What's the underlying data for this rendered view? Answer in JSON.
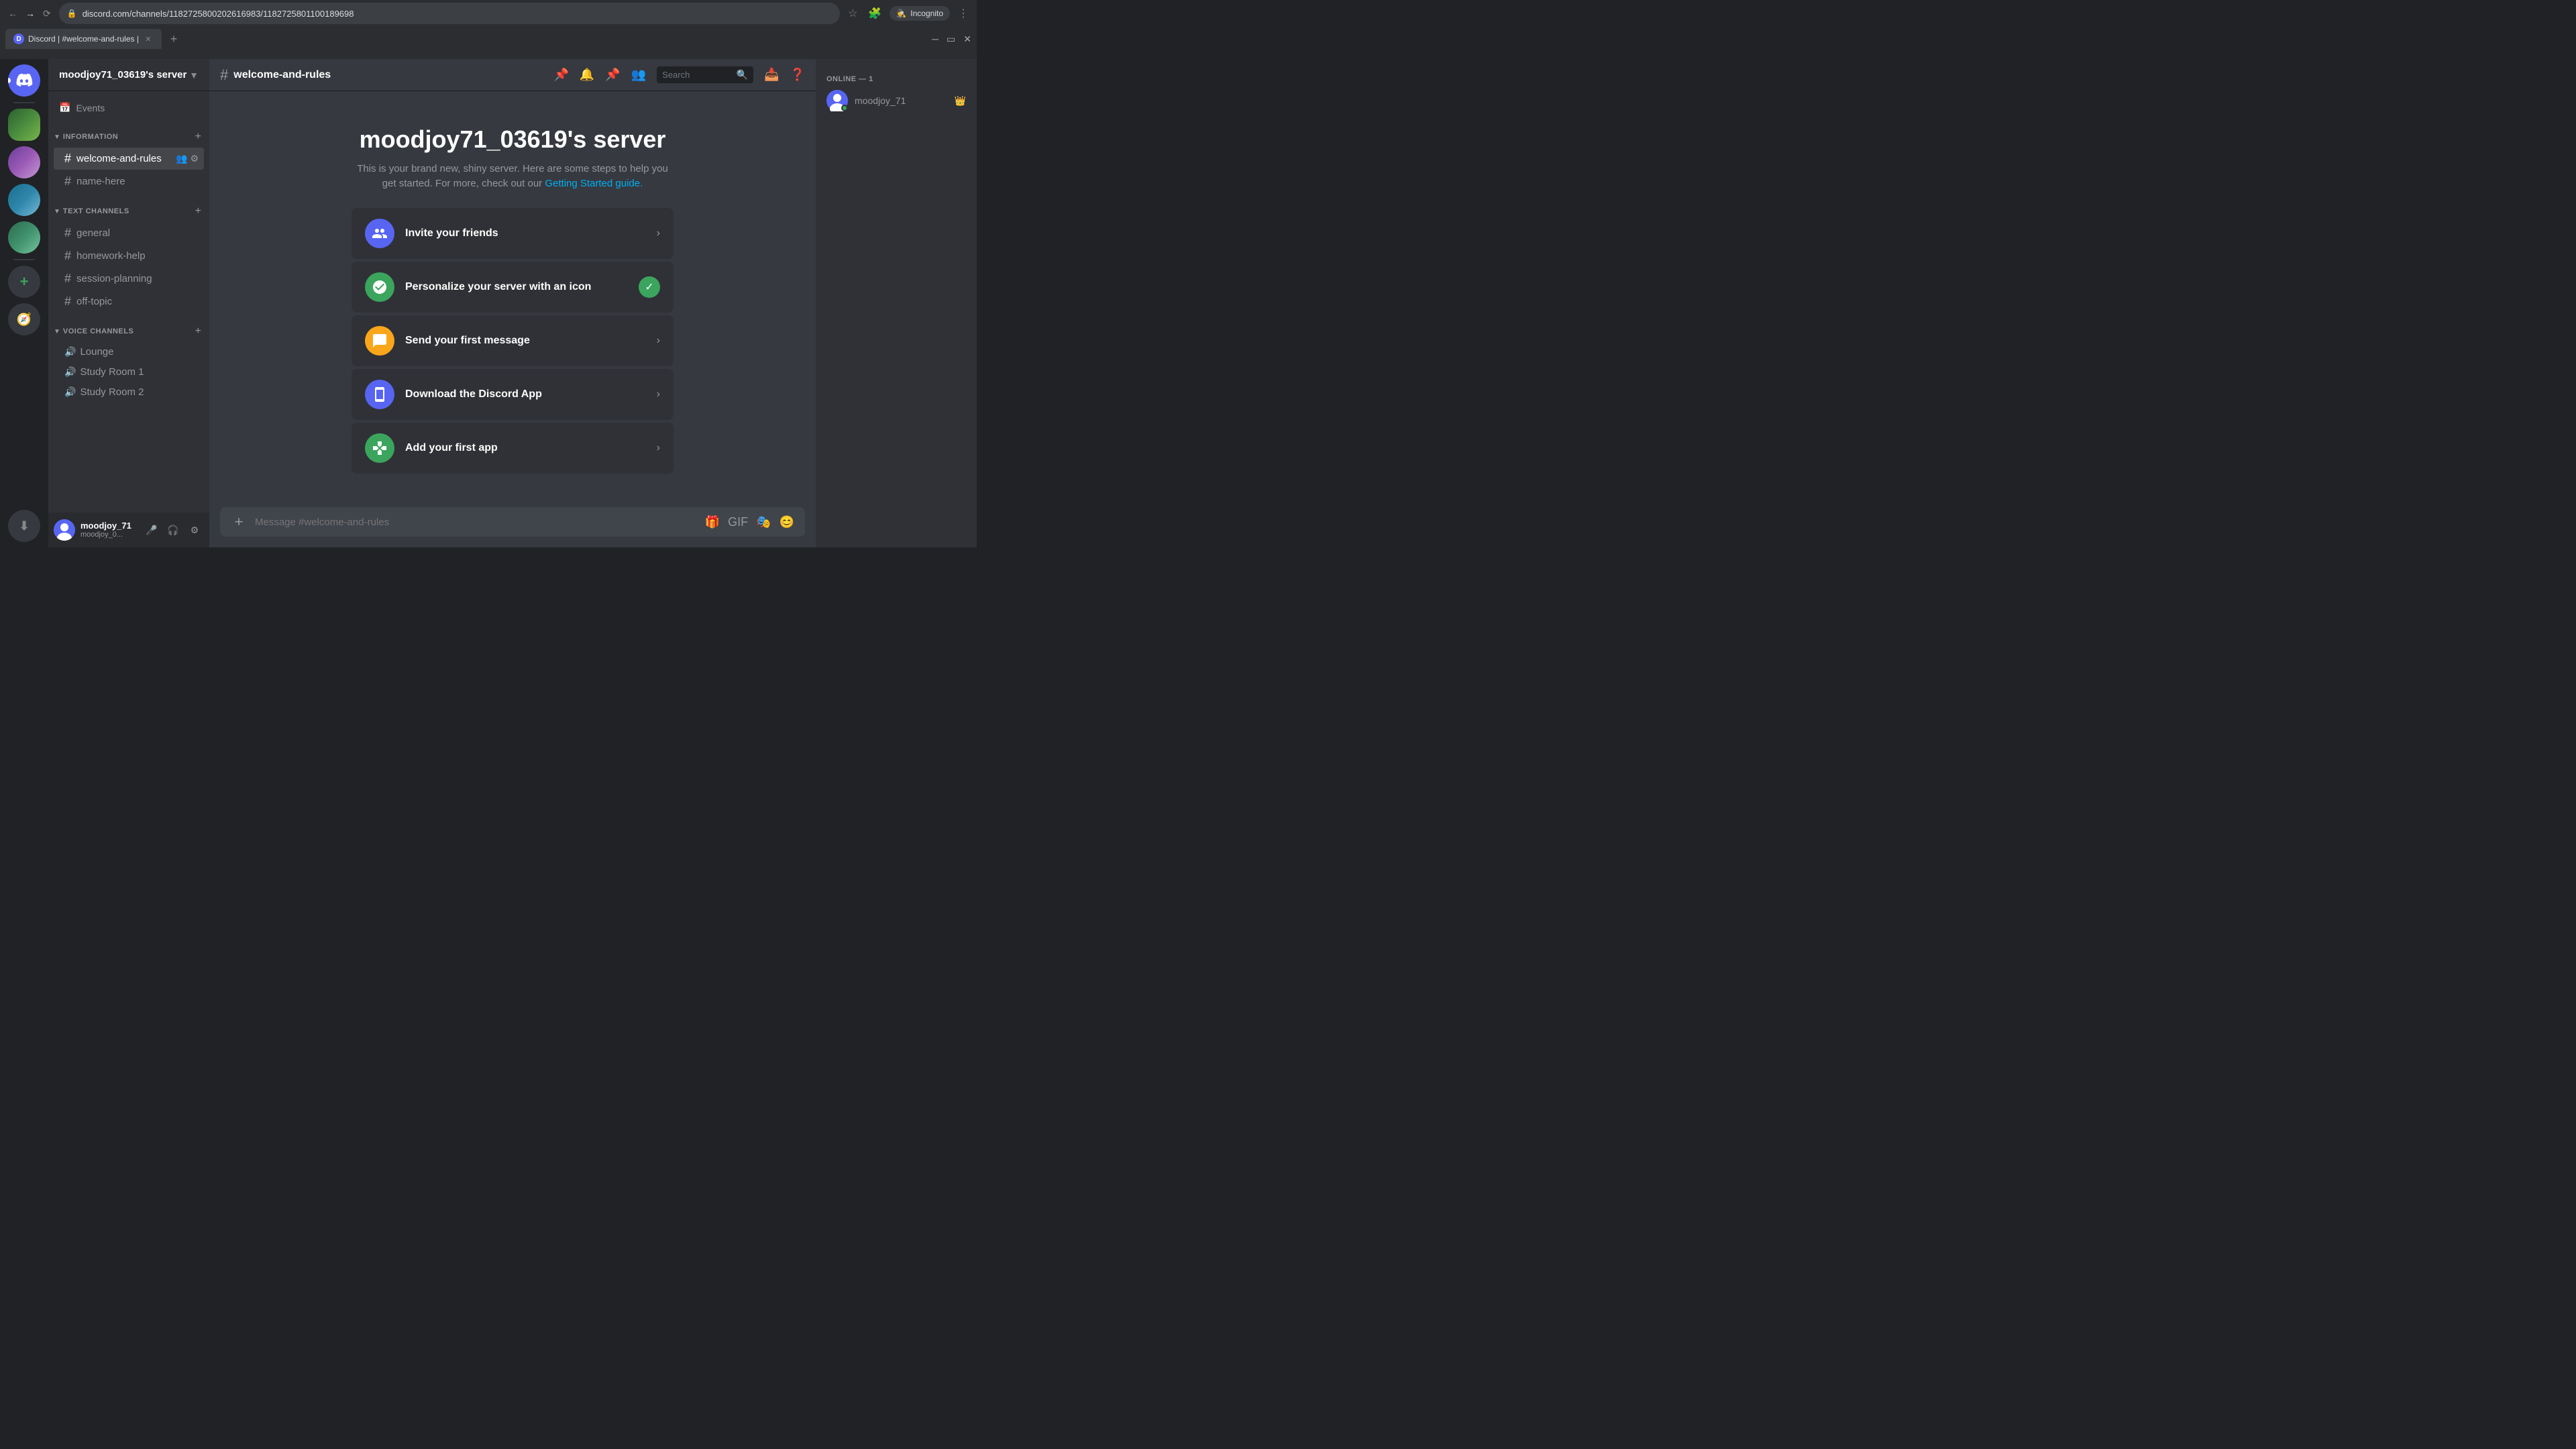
{
  "browser": {
    "tab_title": "Discord | #welcome-and-rules |",
    "url": "discord.com/channels/1182725800202616983/1182725801100189698",
    "incognito_label": "Incognito"
  },
  "sidebar": {
    "servers": [
      {
        "id": "discord-home",
        "label": "Discord Home",
        "type": "home"
      },
      {
        "id": "server-1",
        "label": "Server 1",
        "type": "image"
      },
      {
        "id": "server-2",
        "label": "Server 2",
        "type": "image"
      },
      {
        "id": "server-3",
        "label": "Server 3",
        "type": "image"
      },
      {
        "id": "server-4",
        "label": "Server 4",
        "type": "image"
      }
    ],
    "add_server_label": "Add a Server",
    "discover_label": "Explore Public Servers",
    "download_label": "Download Apps"
  },
  "channel_sidebar": {
    "server_name": "moodjoy71_03619's server",
    "events_label": "Events",
    "categories": [
      {
        "id": "information",
        "name": "INFORMATION",
        "channels": [
          {
            "id": "welcome-and-rules",
            "name": "welcome-and-rules",
            "active": true,
            "type": "text"
          },
          {
            "id": "name-here",
            "name": "name-here",
            "active": false,
            "type": "text"
          }
        ]
      },
      {
        "id": "text-channels",
        "name": "TEXT CHANNELS",
        "channels": [
          {
            "id": "general",
            "name": "general",
            "active": false,
            "type": "text"
          },
          {
            "id": "homework-help",
            "name": "homework-help",
            "active": false,
            "type": "text"
          },
          {
            "id": "session-planning",
            "name": "session-planning",
            "active": false,
            "type": "text"
          },
          {
            "id": "off-topic",
            "name": "off-topic",
            "active": false,
            "type": "text"
          }
        ]
      },
      {
        "id": "voice-channels",
        "name": "VOICE CHANNELS",
        "channels": [
          {
            "id": "lounge",
            "name": "Lounge",
            "type": "voice"
          },
          {
            "id": "study-room-1",
            "name": "Study Room 1",
            "type": "voice"
          },
          {
            "id": "study-room-2",
            "name": "Study Room 2",
            "type": "voice"
          }
        ]
      }
    ]
  },
  "user_area": {
    "username": "moodjoy_71",
    "status": "moodjoy_0...",
    "mute_label": "Mute",
    "deafen_label": "Deafen",
    "settings_label": "User Settings"
  },
  "channel_header": {
    "channel_name": "welcome-and-rules",
    "search_placeholder": "Search"
  },
  "welcome": {
    "server_title": "moodjoy71_03619's server",
    "description": "This is your brand new, shiny server. Here are some steps to help you get started. For more, check out our",
    "getting_started_link": "Getting Started guide.",
    "tasks": [
      {
        "id": "invite-friends",
        "label": "Invite your friends",
        "icon": "👥",
        "icon_style": "purple",
        "completed": false
      },
      {
        "id": "personalize-icon",
        "label": "Personalize your server with an icon",
        "icon": "🎨",
        "icon_style": "green-completed",
        "completed": true
      },
      {
        "id": "first-message",
        "label": "Send your first message",
        "icon": "💬",
        "icon_style": "orange",
        "completed": false
      },
      {
        "id": "download-app",
        "label": "Download the Discord App",
        "icon": "📱",
        "icon_style": "blue",
        "completed": false
      },
      {
        "id": "first-app",
        "label": "Add your first app",
        "icon": "🎮",
        "icon_style": "teal",
        "completed": false
      }
    ]
  },
  "message_input": {
    "placeholder": "Message #welcome-and-rules"
  },
  "member_list": {
    "online_label": "ONLINE — 1",
    "members": [
      {
        "name": "moodjoy_71",
        "status": "online",
        "crown": true
      }
    ]
  }
}
